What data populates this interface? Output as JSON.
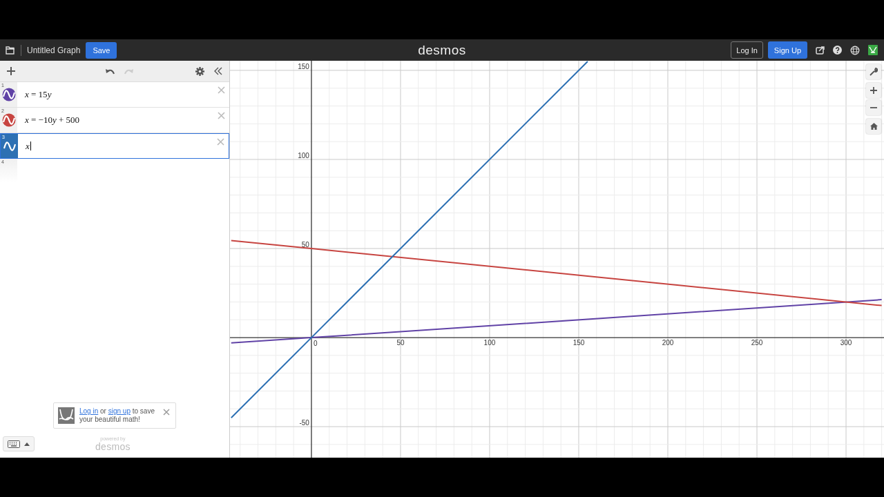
{
  "header": {
    "title": "Untitled Graph",
    "save": "Save",
    "logo": "desmos",
    "login": "Log In",
    "signup": "Sign Up"
  },
  "toolbar": {
    "redo_disabled": true
  },
  "expressions": [
    {
      "number": "1",
      "parts": [
        {
          "kind": "var",
          "text": "x"
        },
        {
          "kind": "op",
          "text": " = 15"
        },
        {
          "kind": "var",
          "text": "y"
        }
      ],
      "color": "#6042a6",
      "selected": false
    },
    {
      "number": "2",
      "parts": [
        {
          "kind": "var",
          "text": "x"
        },
        {
          "kind": "op",
          "text": " = −10"
        },
        {
          "kind": "var",
          "text": "y"
        },
        {
          "kind": "op",
          "text": " + 500"
        }
      ],
      "color": "#c74440",
      "selected": false
    },
    {
      "number": "3",
      "parts": [
        {
          "kind": "var",
          "text": "x"
        }
      ],
      "color": "#2d70b3",
      "selected": true
    }
  ],
  "next_row_number": "4",
  "toast": {
    "segments": [
      {
        "kind": "link",
        "text": "Log in"
      },
      {
        "kind": "text",
        "text": " or "
      },
      {
        "kind": "link",
        "text": "sign up"
      },
      {
        "kind": "text",
        "text": " to save your beautiful math!"
      }
    ]
  },
  "powered": {
    "caption": "powered by",
    "brand": "desmos"
  },
  "graph": {
    "chart_data": {
      "type": "line",
      "x": [
        -45,
        0,
        155,
        320
      ],
      "grid": true,
      "series": [
        {
          "color": "#6042a6",
          "values": [
            -3,
            0,
            10.3,
            21.3
          ]
        },
        {
          "color": "#c74440",
          "values": [
            54.5,
            50,
            34.5,
            18
          ]
        },
        {
          "color": "#2d70b3",
          "values": [
            -45,
            0,
            155,
            null
          ]
        }
      ],
      "xlim": [
        -45.7,
        321.3
      ],
      "ylim": [
        -67.4,
        155.4
      ],
      "xticks": [
        0,
        50,
        100,
        150,
        200,
        250,
        300
      ],
      "yticks": [
        -50,
        50,
        100,
        150
      ]
    }
  }
}
